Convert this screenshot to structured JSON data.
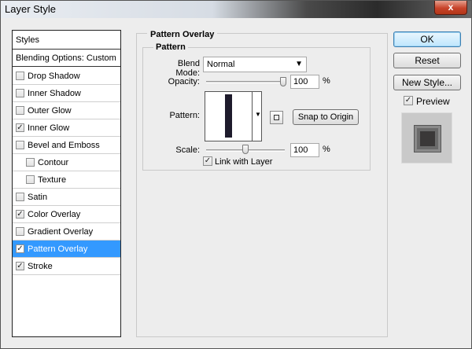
{
  "window": {
    "title": "Layer Style",
    "close_glyph": "x"
  },
  "styles_panel": {
    "header": "Styles",
    "blending_options": "Blending Options: Custom",
    "items": [
      {
        "label": "Drop Shadow",
        "checked": false,
        "indent": false,
        "selected": false
      },
      {
        "label": "Inner Shadow",
        "checked": false,
        "indent": false,
        "selected": false
      },
      {
        "label": "Outer Glow",
        "checked": false,
        "indent": false,
        "selected": false
      },
      {
        "label": "Inner Glow",
        "checked": true,
        "indent": false,
        "selected": false
      },
      {
        "label": "Bevel and Emboss",
        "checked": false,
        "indent": false,
        "selected": false
      },
      {
        "label": "Contour",
        "checked": false,
        "indent": true,
        "selected": false
      },
      {
        "label": "Texture",
        "checked": false,
        "indent": true,
        "selected": false
      },
      {
        "label": "Satin",
        "checked": false,
        "indent": false,
        "selected": false
      },
      {
        "label": "Color Overlay",
        "checked": true,
        "indent": false,
        "selected": false
      },
      {
        "label": "Gradient Overlay",
        "checked": false,
        "indent": false,
        "selected": false
      },
      {
        "label": "Pattern Overlay",
        "checked": true,
        "indent": false,
        "selected": true
      },
      {
        "label": "Stroke",
        "checked": true,
        "indent": false,
        "selected": false
      }
    ]
  },
  "pattern_overlay": {
    "section_title": "Pattern Overlay",
    "group_title": "Pattern",
    "blend_mode_label": "Blend Mode:",
    "blend_mode_value": "Normal",
    "opacity_label": "Opacity:",
    "opacity_value": "100",
    "opacity_unit": "%",
    "opacity_level": 1.0,
    "pattern_label": "Pattern:",
    "snap_button": "Snap to Origin",
    "scale_label": "Scale:",
    "scale_value": "100",
    "scale_unit": "%",
    "link_with_layer_label": "Link with Layer",
    "link_with_layer_checked": true
  },
  "buttons": {
    "ok": "OK",
    "reset": "Reset",
    "new_style": "New Style...",
    "preview_label": "Preview",
    "preview_checked": true
  },
  "check_glyph": "✓",
  "colors": {
    "selection": "#3399ff",
    "pattern_stripe": "#1e1b2c"
  }
}
